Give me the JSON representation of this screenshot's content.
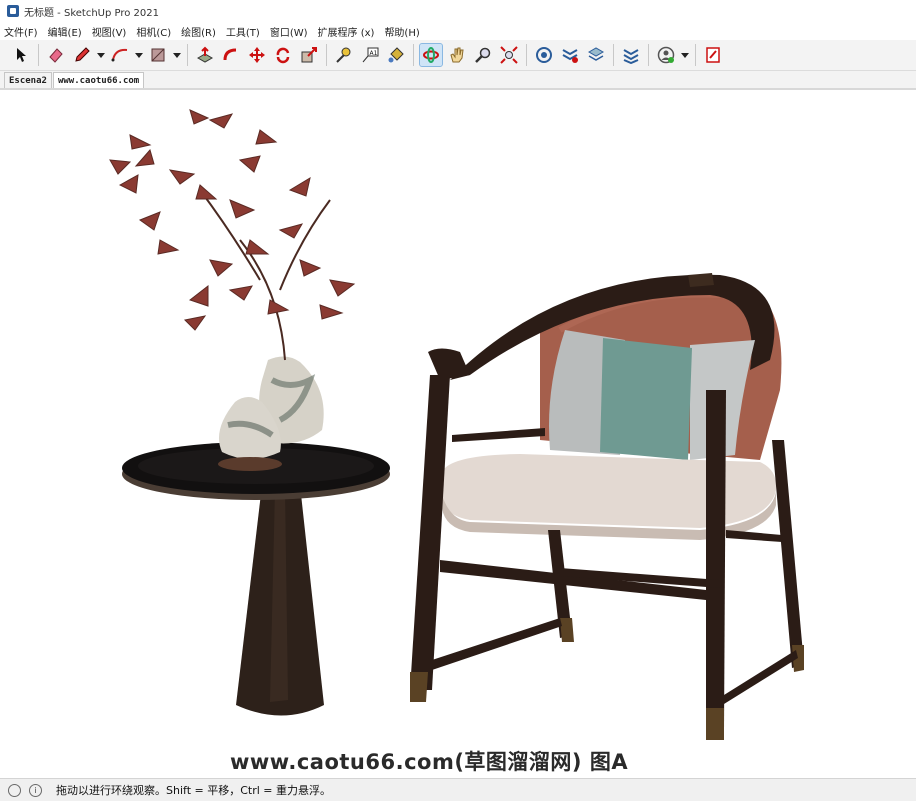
{
  "window": {
    "title": "无标题 - SketchUp Pro 2021"
  },
  "menu": [
    "文件(F)",
    "编辑(E)",
    "视图(V)",
    "相机(C)",
    "绘图(R)",
    "工具(T)",
    "窗口(W)",
    "扩展程序 (x)",
    "帮助(H)"
  ],
  "tabs": [
    "Escena2",
    "www.caotu66.com"
  ],
  "watermark": "www.caotu66.com(草图溜溜网) 图A",
  "status": {
    "text": "拖动以进行环绕观察。Shift = 平移，Ctrl = 重力悬浮。",
    "info_icon": "i"
  },
  "colors": {
    "accent_active": "#cfe4f7",
    "chair_frame": "#2b1c16",
    "back_panel": "#a55f4c",
    "cushion": "#e3d9d2",
    "pillow_teal": "#6f9a92"
  }
}
